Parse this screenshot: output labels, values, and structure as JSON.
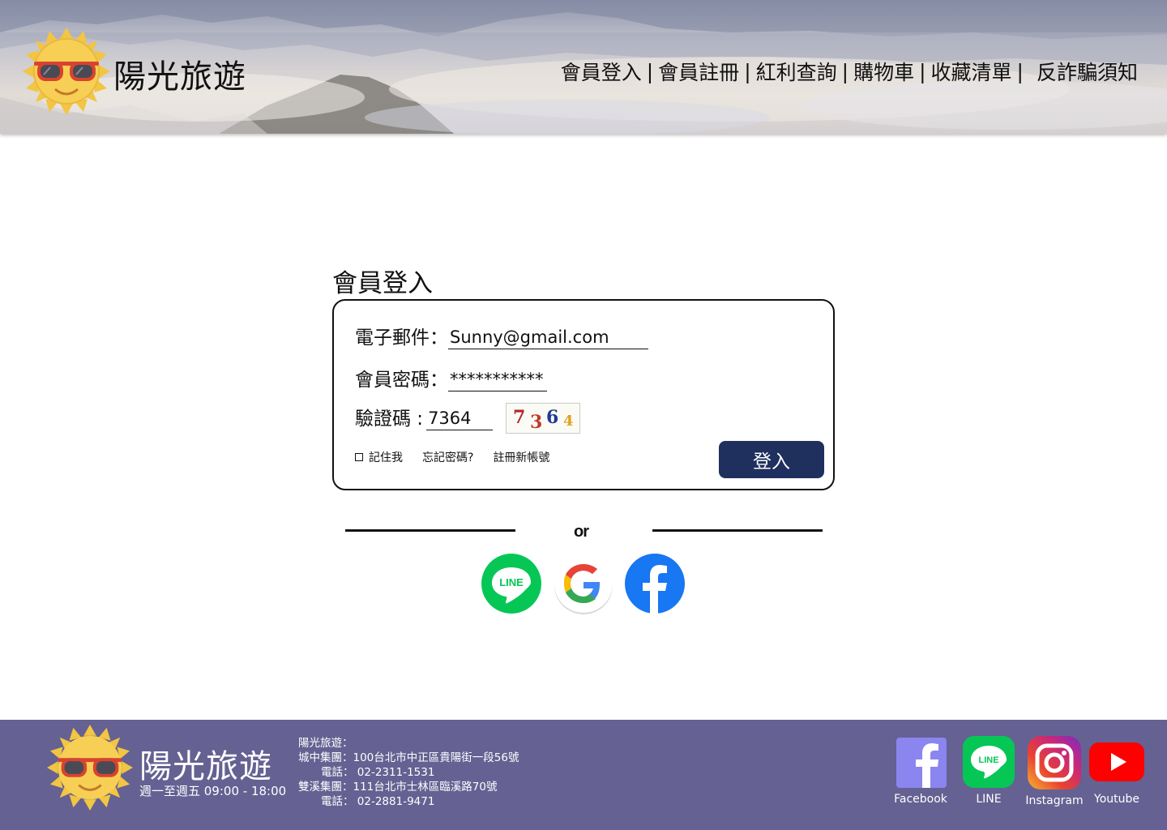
{
  "header": {
    "brand": "陽光旅遊",
    "nav": [
      {
        "label": "會員登入"
      },
      {
        "label": "會員註冊"
      },
      {
        "label": "紅利查詢"
      },
      {
        "label": "購物車"
      },
      {
        "label": "收藏清單"
      },
      {
        "label": "反詐騙須知"
      }
    ],
    "separator": "|"
  },
  "login": {
    "title": "會員登入",
    "email_label": "電子郵件：",
    "email_value": "Sunny@gmail.com",
    "password_label": "會員密碼：",
    "password_value": "***********",
    "captcha_label": "驗證碼 :",
    "captcha_value": "7364",
    "captcha_image_digits": [
      "7",
      "3",
      "6",
      "4"
    ],
    "captcha_colors": [
      "#b3272d",
      "#c0392b",
      "#1f3a93",
      "#e0a21a"
    ],
    "remember_label": "記住我",
    "forgot_label": "忘記密碼?",
    "register_label": "註冊新帳號",
    "submit_label": "登入",
    "submit_color": "#1f2f5e"
  },
  "divider": {
    "label": "or"
  },
  "social_login": [
    {
      "icon": "line-icon",
      "color": "#06c755"
    },
    {
      "icon": "google-icon",
      "color": "#ffffff"
    },
    {
      "icon": "facebook-icon",
      "color": "#1877f2"
    }
  ],
  "footer": {
    "brand": "陽光旅遊",
    "hours": "週一至週五 09:00 - 18:00",
    "info_title": "陽光旅遊：",
    "branch1": "城中集團：100台北市中正區貴陽街一段56號",
    "phone1": "電話： 02-2311-1531",
    "branch2": "雙溪集團：111台北市士林區臨溪路70號",
    "phone2": "電話： 02-2881-9471",
    "background": "#656192",
    "social": [
      {
        "icon": "facebook-icon",
        "label": "Facebook"
      },
      {
        "icon": "line-icon",
        "label": "LINE"
      },
      {
        "icon": "instagram-icon",
        "label": "Instagram"
      },
      {
        "icon": "youtube-icon",
        "label": "Youtube"
      }
    ]
  }
}
